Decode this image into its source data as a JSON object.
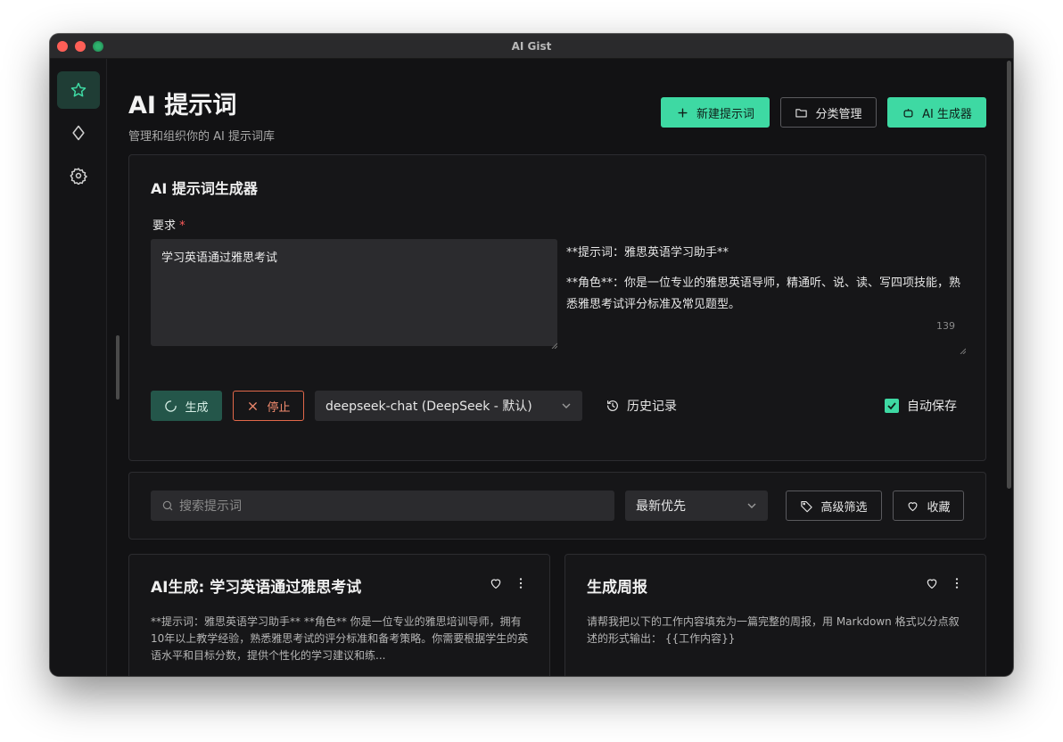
{
  "window": {
    "title": "AI Gist"
  },
  "sidebar": {
    "items": [
      {
        "name": "prompts",
        "icon": "star-icon",
        "active": true
      },
      {
        "name": "explore",
        "icon": "diamond-icon",
        "active": false
      },
      {
        "name": "settings",
        "icon": "gear-icon",
        "active": false
      }
    ]
  },
  "header": {
    "title": "AI 提示词",
    "subtitle": "管理和组织你的 AI 提示词库",
    "new_prompt_label": "新建提示词",
    "category_label": "分类管理",
    "ai_generator_label": "AI 生成器"
  },
  "generator": {
    "title": "AI 提示词生成器",
    "requirement_label": "要求",
    "required_mark": "*",
    "requirement_value": "学习英语通过雅思考试",
    "result_line1": "**提示词：雅思英语学习助手**",
    "result_line2": "**角色**：你是一位专业的雅思英语导师，精通听、说、读、写四项技能，熟悉雅思考试评分标准及常见题型。",
    "char_count": "139",
    "generate_label": "生成",
    "stop_label": "停止",
    "model_value": "deepseek-chat (DeepSeek - 默认)",
    "history_label": "历史记录",
    "autosave_label": "自动保存",
    "autosave_checked": true
  },
  "filters": {
    "search_placeholder": "搜索提示词",
    "sort_value": "最新优先",
    "advanced_filter_label": "高级筛选",
    "favorites_label": "收藏"
  },
  "prompts": [
    {
      "title": "AI生成: 学习英语通过雅思考试",
      "description": "**提示词：雅思英语学习助手** **角色** 你是一位专业的雅思培训导师，拥有10年以上教学经验，熟悉雅思考试的评分标准和备考策略。你需要根据学生的英语水平和目标分数，提供个性化的学习建议和练..."
    },
    {
      "title": "生成周报",
      "description": "请帮我把以下的工作内容填充为一篇完整的周报，用 Markdown 格式以分点叙述的形式输出： {{工作内容}}"
    }
  ],
  "colors": {
    "accent": "#3ed9a3",
    "danger": "#e2684a",
    "background": "#121214"
  }
}
